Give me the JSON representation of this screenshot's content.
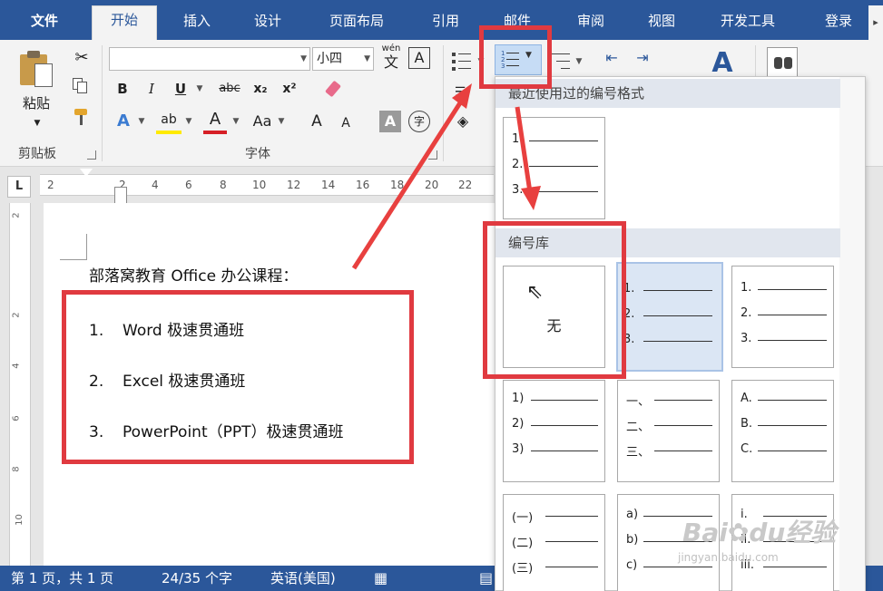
{
  "tabs": {
    "file": "文件",
    "home": "开始",
    "insert": "插入",
    "design": "设计",
    "layout": "页面布局",
    "references": "引用",
    "mailings": "邮件",
    "review": "审阅",
    "view": "视图",
    "developer": "开发工具",
    "login": "登录",
    "more_icon": "chevron-right-icon"
  },
  "ribbon": {
    "clipboard": {
      "paste_label": "粘贴",
      "group_label": "剪贴板"
    },
    "font": {
      "font_name_value": "",
      "font_size_value": "小四",
      "phonetic_label": "wén",
      "phonetic_char": "文",
      "char_border_label": "A",
      "bold": "B",
      "italic": "I",
      "underline": "U",
      "strike": "abc",
      "subscript": "x₂",
      "superscript": "x²",
      "text_effect": "A",
      "highlight": "ab",
      "font_color": "A",
      "change_case": "Aa",
      "grow_font": "A",
      "shrink_font": "A",
      "char_shading": "A",
      "enclose_char": "字",
      "group_label": "字体"
    },
    "styles_label": "A"
  },
  "ruler": {
    "corner": "L",
    "numbers": [
      "2",
      "2",
      "4",
      "6",
      "8",
      "10",
      "12",
      "14",
      "16",
      "18",
      "20",
      "22"
    ],
    "vertical": [
      "2",
      "2",
      "4",
      "6",
      "8",
      "10"
    ]
  },
  "document": {
    "title": "部落窝教育 Office 办公课程：",
    "items": [
      {
        "num": "1.",
        "text": "Word 极速贯通班"
      },
      {
        "num": "2.",
        "text": "Excel 极速贯通班"
      },
      {
        "num": "3.",
        "text": "PowerPoint（PPT）极速贯通班"
      }
    ]
  },
  "numbering_panel": {
    "recent_header": "最近使用过的编号格式",
    "recent_tile": [
      "1.",
      "2.",
      "3."
    ],
    "library_header": "编号库",
    "none_label": "无",
    "tiles": [
      [
        "1.",
        "2.",
        "3."
      ],
      [
        "1.",
        "2.",
        "3."
      ],
      [
        "1)",
        "2)",
        "3)"
      ],
      [
        "一、",
        "二、",
        "三、"
      ],
      [
        "A.",
        "B.",
        "C."
      ],
      [
        "(一)",
        "(二)",
        "(三)"
      ],
      [
        "a)",
        "b)",
        "c)"
      ],
      [
        "i.",
        "ii.",
        "iii."
      ]
    ]
  },
  "status": {
    "page": "第 1 页，共 1 页",
    "words": "24/35 个字",
    "language": "英语(美国)"
  },
  "watermark": {
    "brand": "Bai",
    "brand_mid": "du",
    "brand_cn": "经验",
    "url": "jingyan.baidu.com"
  },
  "colors": {
    "ribbon_blue": "#2b579a",
    "highlight_red": "#e03a40"
  }
}
